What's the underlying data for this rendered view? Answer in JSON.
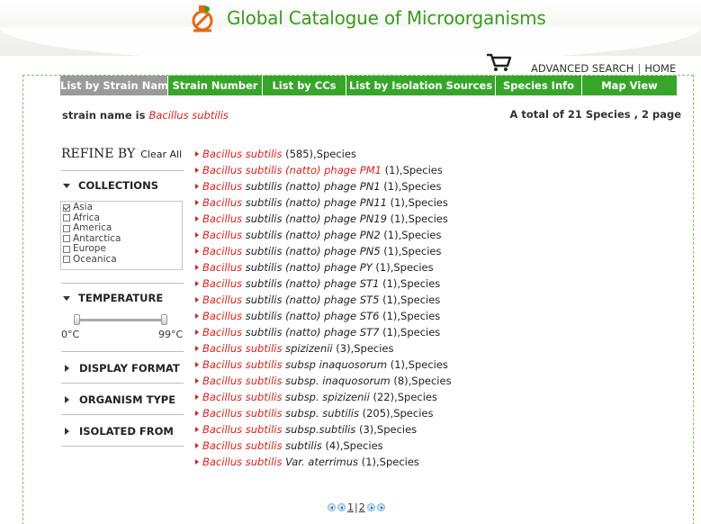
{
  "header": {
    "title": "Global Catalogue of Microorganisms"
  },
  "toplinks": {
    "advanced": "ADVANCED SEARCH",
    "sep": "|",
    "home": "HOME"
  },
  "tabs": [
    {
      "label": "List by Strain Name"
    },
    {
      "label": "Strain Number"
    },
    {
      "label": "List by CCs"
    },
    {
      "label": "List by Isolation Sources"
    },
    {
      "label": "Species Info"
    },
    {
      "label": "Map View"
    }
  ],
  "query": {
    "prefix": "strain name is",
    "term": "Bacillus subtilis"
  },
  "total": "A total of 21 Species , 2 page",
  "refine": {
    "title": "REFINE BY",
    "clear": "Clear All",
    "collections": {
      "label": "COLLECTIONS",
      "items": [
        {
          "label": "Asia",
          "checked": true
        },
        {
          "label": "Africa",
          "checked": false
        },
        {
          "label": "America",
          "checked": false
        },
        {
          "label": "Antarctica",
          "checked": false
        },
        {
          "label": "Europe",
          "checked": false
        },
        {
          "label": "Oceanica",
          "checked": false
        }
      ]
    },
    "temperature": {
      "label": "TEMPERATURE",
      "min": "0°C",
      "max": "99°C"
    },
    "display_format": "DISPLAY FORMAT",
    "organism_type": "ORGANISM TYPE",
    "isolated_from": "ISOLATED FROM"
  },
  "results": [
    {
      "genus": "Bacillus subtilis",
      "rest": "",
      "count": "(585),Species"
    },
    {
      "genus": "Bacillus subtilis (natto) phage PM1",
      "rest": "",
      "count": "(1),Species"
    },
    {
      "genus": "Bacillus",
      "rest": "subtilis (natto) phage PN1",
      "count": "(1),Species"
    },
    {
      "genus": "Bacillus",
      "rest": "subtilis (natto) phage PN11",
      "count": "(1),Species"
    },
    {
      "genus": "Bacillus",
      "rest": "subtilis (natto) phage PN19",
      "count": "(1),Species"
    },
    {
      "genus": "Bacillus",
      "rest": "subtilis (natto) phage PN2",
      "count": "(1),Species"
    },
    {
      "genus": "Bacillus",
      "rest": "subtilis (natto) phage PN5",
      "count": "(1),Species"
    },
    {
      "genus": "Bacillus",
      "rest": "subtilis (natto) phage PY",
      "count": "(1),Species"
    },
    {
      "genus": "Bacillus",
      "rest": "subtilis (natto) phage ST1",
      "count": "(1),Species"
    },
    {
      "genus": "Bacillus",
      "rest": "subtilis (natto) phage ST5",
      "count": "(1),Species"
    },
    {
      "genus": "Bacillus",
      "rest": "subtilis (natto) phage ST6",
      "count": "(1),Species"
    },
    {
      "genus": "Bacillus",
      "rest": "subtilis (natto) phage ST7",
      "count": "(1),Species"
    },
    {
      "genus": "Bacillus subtilis",
      "rest": "spizizenii",
      "count": "(3),Species"
    },
    {
      "genus": "Bacillus subtilis",
      "rest": "subsp inaquosorum",
      "count": "(1),Species"
    },
    {
      "genus": "Bacillus subtilis",
      "rest": "subsp. inaquosorum",
      "count": "(8),Species"
    },
    {
      "genus": "Bacillus subtilis",
      "rest": "subsp. spizizenii",
      "count": "(22),Species"
    },
    {
      "genus": "Bacillus subtilis",
      "rest": "subsp. subtilis",
      "count": "(205),Species"
    },
    {
      "genus": "Bacillus subtilis",
      "rest": "subsp.subtilis",
      "count": "(3),Species"
    },
    {
      "genus": "Bacillus subtilis",
      "rest": "subtilis",
      "count": "(4),Species"
    },
    {
      "genus": "Bacillus subtilis",
      "rest": "Var. aterrimus",
      "count": "(1),Species"
    }
  ],
  "pager": {
    "page1": "1",
    "sep": "|",
    "page2": "2"
  },
  "colors": {
    "brand_green": "#37a52a",
    "title_green": "#3a9a1e",
    "accent_red": "#d42020",
    "tab_active": "#9a9a9a"
  },
  "icons": {
    "logo": "microbe-logo-icon",
    "cart": "cart-icon"
  }
}
